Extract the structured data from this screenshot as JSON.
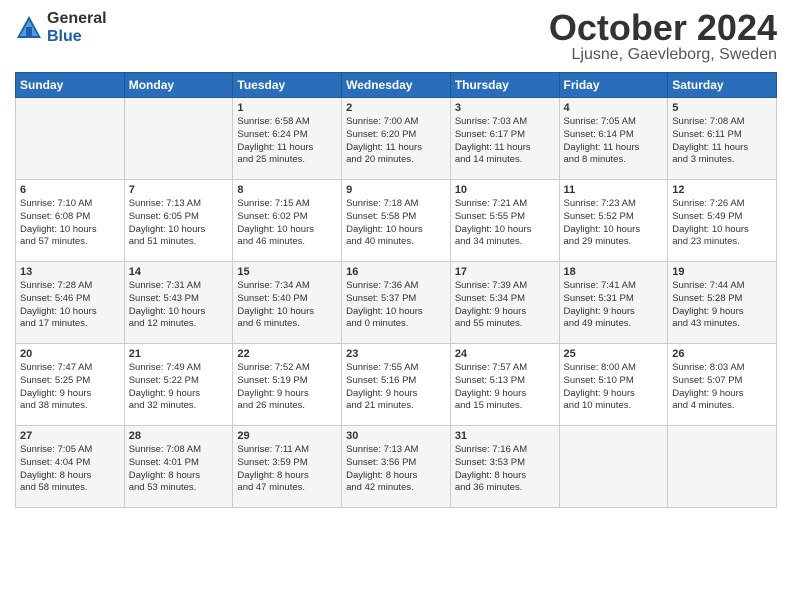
{
  "header": {
    "logo_general": "General",
    "logo_blue": "Blue",
    "month_title": "October 2024",
    "location": "Ljusne, Gaevleborg, Sweden"
  },
  "weekdays": [
    "Sunday",
    "Monday",
    "Tuesday",
    "Wednesday",
    "Thursday",
    "Friday",
    "Saturday"
  ],
  "rows": [
    [
      {
        "day": "",
        "info": ""
      },
      {
        "day": "",
        "info": ""
      },
      {
        "day": "1",
        "info": "Sunrise: 6:58 AM\nSunset: 6:24 PM\nDaylight: 11 hours\nand 25 minutes."
      },
      {
        "day": "2",
        "info": "Sunrise: 7:00 AM\nSunset: 6:20 PM\nDaylight: 11 hours\nand 20 minutes."
      },
      {
        "day": "3",
        "info": "Sunrise: 7:03 AM\nSunset: 6:17 PM\nDaylight: 11 hours\nand 14 minutes."
      },
      {
        "day": "4",
        "info": "Sunrise: 7:05 AM\nSunset: 6:14 PM\nDaylight: 11 hours\nand 8 minutes."
      },
      {
        "day": "5",
        "info": "Sunrise: 7:08 AM\nSunset: 6:11 PM\nDaylight: 11 hours\nand 3 minutes."
      }
    ],
    [
      {
        "day": "6",
        "info": "Sunrise: 7:10 AM\nSunset: 6:08 PM\nDaylight: 10 hours\nand 57 minutes."
      },
      {
        "day": "7",
        "info": "Sunrise: 7:13 AM\nSunset: 6:05 PM\nDaylight: 10 hours\nand 51 minutes."
      },
      {
        "day": "8",
        "info": "Sunrise: 7:15 AM\nSunset: 6:02 PM\nDaylight: 10 hours\nand 46 minutes."
      },
      {
        "day": "9",
        "info": "Sunrise: 7:18 AM\nSunset: 5:58 PM\nDaylight: 10 hours\nand 40 minutes."
      },
      {
        "day": "10",
        "info": "Sunrise: 7:21 AM\nSunset: 5:55 PM\nDaylight: 10 hours\nand 34 minutes."
      },
      {
        "day": "11",
        "info": "Sunrise: 7:23 AM\nSunset: 5:52 PM\nDaylight: 10 hours\nand 29 minutes."
      },
      {
        "day": "12",
        "info": "Sunrise: 7:26 AM\nSunset: 5:49 PM\nDaylight: 10 hours\nand 23 minutes."
      }
    ],
    [
      {
        "day": "13",
        "info": "Sunrise: 7:28 AM\nSunset: 5:46 PM\nDaylight: 10 hours\nand 17 minutes."
      },
      {
        "day": "14",
        "info": "Sunrise: 7:31 AM\nSunset: 5:43 PM\nDaylight: 10 hours\nand 12 minutes."
      },
      {
        "day": "15",
        "info": "Sunrise: 7:34 AM\nSunset: 5:40 PM\nDaylight: 10 hours\nand 6 minutes."
      },
      {
        "day": "16",
        "info": "Sunrise: 7:36 AM\nSunset: 5:37 PM\nDaylight: 10 hours\nand 0 minutes."
      },
      {
        "day": "17",
        "info": "Sunrise: 7:39 AM\nSunset: 5:34 PM\nDaylight: 9 hours\nand 55 minutes."
      },
      {
        "day": "18",
        "info": "Sunrise: 7:41 AM\nSunset: 5:31 PM\nDaylight: 9 hours\nand 49 minutes."
      },
      {
        "day": "19",
        "info": "Sunrise: 7:44 AM\nSunset: 5:28 PM\nDaylight: 9 hours\nand 43 minutes."
      }
    ],
    [
      {
        "day": "20",
        "info": "Sunrise: 7:47 AM\nSunset: 5:25 PM\nDaylight: 9 hours\nand 38 minutes."
      },
      {
        "day": "21",
        "info": "Sunrise: 7:49 AM\nSunset: 5:22 PM\nDaylight: 9 hours\nand 32 minutes."
      },
      {
        "day": "22",
        "info": "Sunrise: 7:52 AM\nSunset: 5:19 PM\nDaylight: 9 hours\nand 26 minutes."
      },
      {
        "day": "23",
        "info": "Sunrise: 7:55 AM\nSunset: 5:16 PM\nDaylight: 9 hours\nand 21 minutes."
      },
      {
        "day": "24",
        "info": "Sunrise: 7:57 AM\nSunset: 5:13 PM\nDaylight: 9 hours\nand 15 minutes."
      },
      {
        "day": "25",
        "info": "Sunrise: 8:00 AM\nSunset: 5:10 PM\nDaylight: 9 hours\nand 10 minutes."
      },
      {
        "day": "26",
        "info": "Sunrise: 8:03 AM\nSunset: 5:07 PM\nDaylight: 9 hours\nand 4 minutes."
      }
    ],
    [
      {
        "day": "27",
        "info": "Sunrise: 7:05 AM\nSunset: 4:04 PM\nDaylight: 8 hours\nand 58 minutes."
      },
      {
        "day": "28",
        "info": "Sunrise: 7:08 AM\nSunset: 4:01 PM\nDaylight: 8 hours\nand 53 minutes."
      },
      {
        "day": "29",
        "info": "Sunrise: 7:11 AM\nSunset: 3:59 PM\nDaylight: 8 hours\nand 47 minutes."
      },
      {
        "day": "30",
        "info": "Sunrise: 7:13 AM\nSunset: 3:56 PM\nDaylight: 8 hours\nand 42 minutes."
      },
      {
        "day": "31",
        "info": "Sunrise: 7:16 AM\nSunset: 3:53 PM\nDaylight: 8 hours\nand 36 minutes."
      },
      {
        "day": "",
        "info": ""
      },
      {
        "day": "",
        "info": ""
      }
    ]
  ]
}
